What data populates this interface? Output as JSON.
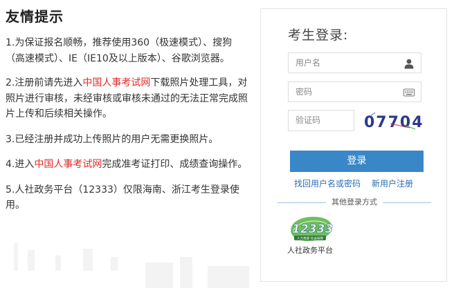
{
  "tips": {
    "title": "友情提示",
    "items": [
      {
        "parts": [
          "1.为保证报名顺畅，推荐使用360（极速模式）、搜狗（高速模式）、IE（IE10及以上版本）、谷歌浏览器。"
        ]
      },
      {
        "before": "2.注册前请先进入",
        "link": "中国人事考试网",
        "after": "下载照片处理工具，对照片进行审核，未经审核或审核未通过的无法正常完成照片上传和后续相关操作。"
      },
      {
        "parts": [
          "3.已经注册并成功上传照片的用户无需更换照片。"
        ]
      },
      {
        "before": "4.进入",
        "link": "中国人事考试网",
        "after": "完成准考证打印、成绩查询操作。"
      },
      {
        "parts": [
          "5.人社政务平台（12333）仅限海南、浙江考生登录使用。"
        ]
      }
    ]
  },
  "login": {
    "title": "考生登录:",
    "username": {
      "placeholder": "用户名",
      "value": "",
      "icon": "user-icon"
    },
    "password": {
      "placeholder": "密码",
      "value": "",
      "icon": "keyboard-icon"
    },
    "captcha": {
      "placeholder": "验证码",
      "value": "",
      "image_text": "07704"
    },
    "submit_label": "登录",
    "forgot_label": "找回用户名或密码",
    "register_label": "新用户注册",
    "other_methods_label": "其他登录方式",
    "alt": {
      "logo_text": "12333",
      "logo_subtext": "人力资源 社会保障",
      "label": "人社政务平台",
      "icon": "12333-logo"
    }
  },
  "colors": {
    "accent": "#3a87c8",
    "link_red": "#e02b27",
    "link_blue": "#2a6db5",
    "logo_green": "#3d9a3a"
  }
}
